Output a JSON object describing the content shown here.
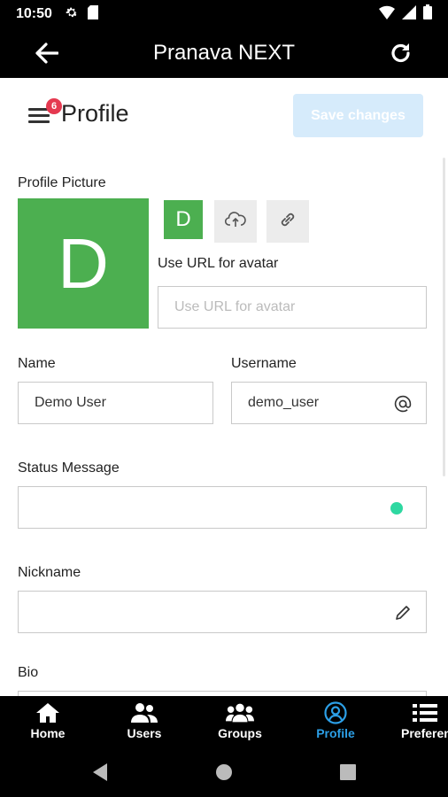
{
  "status_bar": {
    "time": "10:50"
  },
  "app_bar": {
    "title": "Pranava NEXT"
  },
  "header": {
    "title": "Profile",
    "badge_count": "6",
    "save_label": "Save changes"
  },
  "profile_picture": {
    "label": "Profile Picture",
    "avatar_letter": "D",
    "small_avatar_letter": "D",
    "url_label": "Use URL for avatar",
    "url_placeholder": "Use URL for avatar"
  },
  "form": {
    "name_label": "Name",
    "name_value": "Demo User",
    "username_label": "Username",
    "username_value": "demo_user",
    "status_label": "Status Message",
    "status_value": "",
    "nickname_label": "Nickname",
    "nickname_value": "",
    "bio_label": "Bio"
  },
  "bottom_nav": {
    "items": [
      {
        "label": "Home",
        "icon": "home-icon"
      },
      {
        "label": "Users",
        "icon": "users-icon"
      },
      {
        "label": "Groups",
        "icon": "groups-icon"
      },
      {
        "label": "Profile",
        "icon": "profile-icon",
        "active": true
      },
      {
        "label": "Preferen",
        "icon": "list-icon"
      }
    ]
  },
  "colors": {
    "accent": "#2c9fe6",
    "avatar": "#4caf50",
    "badge": "#e53950",
    "status_dot": "#2ed8a1",
    "save_button": "#d6ebfb"
  }
}
